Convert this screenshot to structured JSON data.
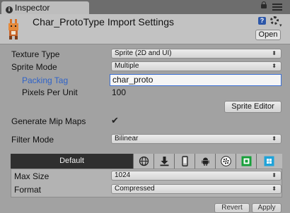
{
  "window": {
    "tab_label": "Inspector"
  },
  "header": {
    "title": "Char_ProtoType Import Settings",
    "open_button": "Open"
  },
  "settings": {
    "texture_type": {
      "label": "Texture Type",
      "value": "Sprite (2D and UI)"
    },
    "sprite_mode": {
      "label": "Sprite Mode",
      "value": "Multiple"
    },
    "packing_tag": {
      "label": "Packing Tag",
      "value": "char_proto"
    },
    "pixels_per_unit": {
      "label": "Pixels Per Unit",
      "value": "100"
    },
    "sprite_editor_button": "Sprite Editor",
    "generate_mip_maps": {
      "label": "Generate Mip Maps",
      "checked": true,
      "check_glyph": "✔"
    },
    "filter_mode": {
      "label": "Filter Mode",
      "value": "Bilinear"
    }
  },
  "platform_tabs": {
    "default_label": "Default",
    "icons": [
      "web-globe-icon",
      "standalone-download-icon",
      "ios-phone-icon",
      "android-icon",
      "blackberry-icon",
      "xbox-icon",
      "windows-store-icon"
    ]
  },
  "platform_settings": {
    "max_size": {
      "label": "Max Size",
      "value": "1024"
    },
    "format": {
      "label": "Format",
      "value": "Compressed"
    }
  },
  "footer": {
    "revert_button": "Revert",
    "apply_button": "Apply"
  },
  "colors": {
    "accent_blue": "#2f63c8",
    "selected_tab": "#2f2f2f",
    "background": "#a2a2a2"
  }
}
